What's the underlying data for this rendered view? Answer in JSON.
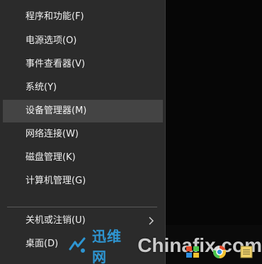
{
  "menu": {
    "items": [
      {
        "label": "程序和功能(F)"
      },
      {
        "label": "电源选项(O)"
      },
      {
        "label": "事件查看器(V)"
      },
      {
        "label": "系统(Y)"
      },
      {
        "label": "设备管理器(M)"
      },
      {
        "label": "网络连接(W)"
      },
      {
        "label": "磁盘管理(K)"
      },
      {
        "label": "计算机管理(G)"
      },
      {
        "label": "关机或注销(U)"
      },
      {
        "label": "桌面(D)"
      }
    ],
    "highlighted_item": "设备管理器(M)"
  },
  "watermark": {
    "cn": "迅维网",
    "en": "Chinafix.com"
  },
  "colors": {
    "menu_bg": "#2b2b2b",
    "hover_bg": "#444444",
    "text": "#f2f2f2",
    "watermark_blue": "#2f9fe0"
  },
  "icons": [
    "chevron-right-icon",
    "watermark-logo-icon",
    "tray-icons"
  ]
}
